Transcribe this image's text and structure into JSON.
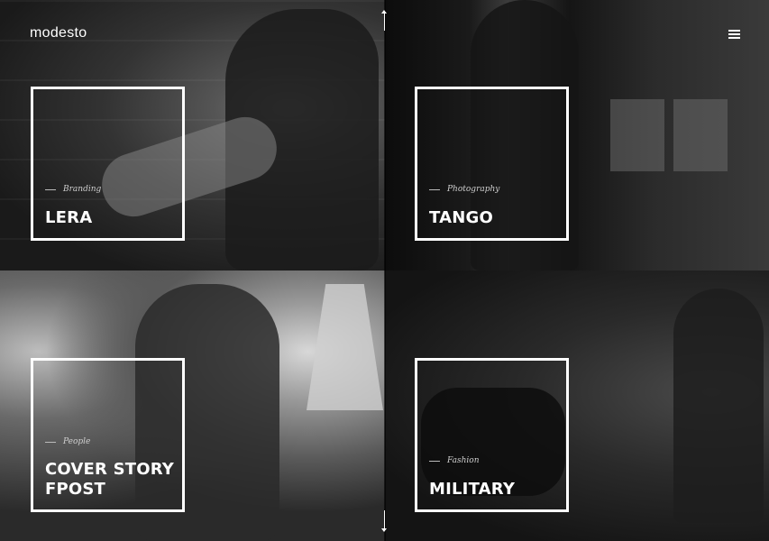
{
  "header": {
    "logo": "modesto",
    "menu_icon": "hamburger-menu-icon"
  },
  "projects": [
    {
      "category": "Branding",
      "title": "LERA"
    },
    {
      "category": "Photography",
      "title": "TANGO"
    },
    {
      "category": "People",
      "title": "COVER STORY FPOST"
    },
    {
      "category": "Fashion",
      "title": "MILITARY"
    }
  ],
  "scroll": {
    "up_icon": "arrow-up-icon",
    "down_icon": "arrow-down-icon"
  },
  "colors": {
    "text": "#ffffff",
    "category_text": "#cfcfcf",
    "background": "#111111"
  }
}
